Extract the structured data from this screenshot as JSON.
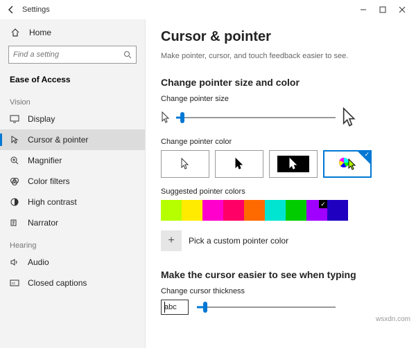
{
  "titlebar": {
    "app_name": "Settings"
  },
  "sidebar": {
    "home": "Home",
    "search_placeholder": "Find a setting",
    "breadcrumb": "Ease of Access",
    "groups": {
      "vision": {
        "header": "Vision",
        "items": [
          "Display",
          "Cursor & pointer",
          "Magnifier",
          "Color filters",
          "High contrast",
          "Narrator"
        ]
      },
      "hearing": {
        "header": "Hearing",
        "items": [
          "Audio",
          "Closed captions"
        ]
      }
    }
  },
  "main": {
    "title": "Cursor & pointer",
    "description": "Make pointer, cursor, and touch feedback easier to see.",
    "section1": {
      "heading": "Change pointer size and color",
      "size_label": "Change pointer size",
      "color_label": "Change pointer color",
      "suggested_label": "Suggested pointer colors",
      "custom_label": "Pick a custom pointer color"
    },
    "section2": {
      "heading": "Make the cursor easier to see when typing",
      "thickness_label": "Change cursor thickness",
      "sample_text": "abc"
    },
    "suggested_colors": [
      "#b6ff00",
      "#ffeb00",
      "#ff00cc",
      "#ff0066",
      "#ff6a00",
      "#00e5d1",
      "#00cc00",
      "#a000ff",
      "#2000c0"
    ],
    "selected_swatch_index": 7
  },
  "watermark": "wsxdn.com"
}
